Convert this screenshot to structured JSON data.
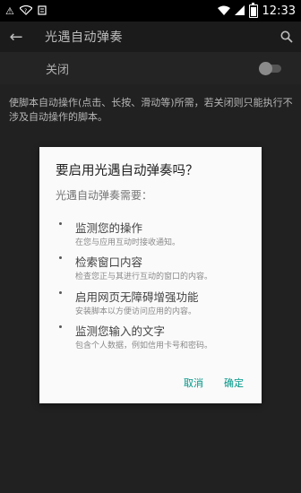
{
  "status_bar": {
    "time": "12:33",
    "left_icons": [
      "warning-icon",
      "wifi-question-icon",
      "notification-icon"
    ],
    "right_icons": [
      "wifi-icon",
      "signal-icon",
      "battery-icon"
    ],
    "battery_level": 0.9
  },
  "app_bar": {
    "title": "光遇自动弹奏"
  },
  "toggle_row": {
    "label": "关闭",
    "state": "off"
  },
  "description": "使脚本自动操作(点击、长按、滑动等)所需，若关闭则只能执行不涉及自动操作的脚本。",
  "dialog": {
    "title": "要启用光遇自动弹奏吗？",
    "subtitle": "光遇自动弹奏需要：",
    "permissions": [
      {
        "title": "监测您的操作",
        "desc": "在您与应用互动时接收通知。"
      },
      {
        "title": "检索窗口内容",
        "desc": "检查您正与其进行互动的窗口的内容。"
      },
      {
        "title": "启用网页无障碍增强功能",
        "desc": "安装脚本以方便访问应用的内容。"
      },
      {
        "title": "监测您输入的文字",
        "desc": "包含个人数据，例如信用卡号和密码。"
      }
    ],
    "cancel_label": "取消",
    "ok_label": "确定"
  },
  "colors": {
    "accent": "#009688",
    "background": "#212121",
    "dialog": "#fafafa"
  }
}
